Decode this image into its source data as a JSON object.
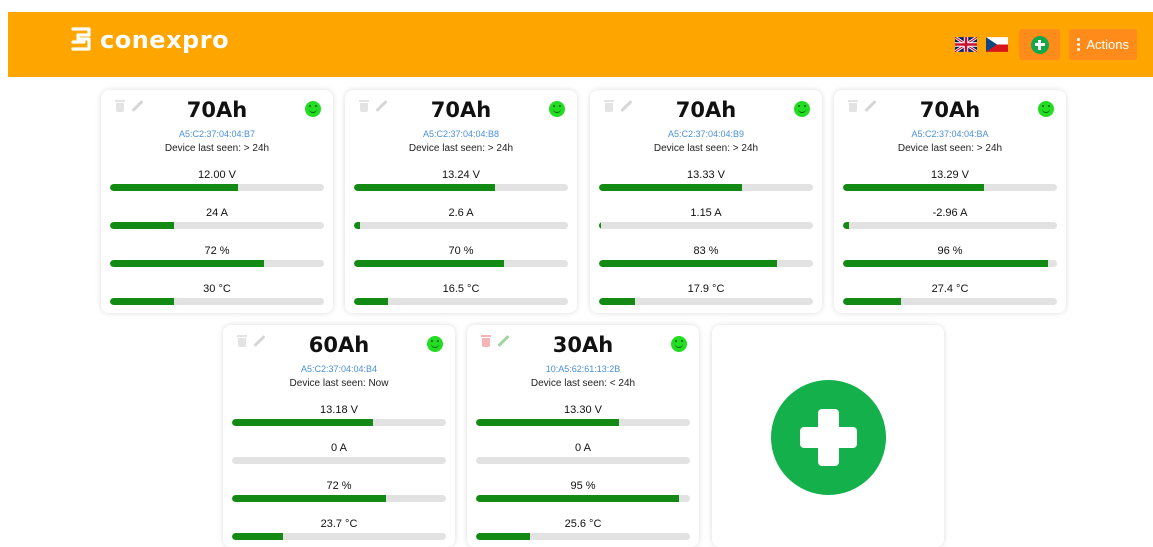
{
  "header": {
    "brand": "conexpro",
    "lang_en_icon": "uk-flag-icon",
    "lang_cz_icon": "cz-flag-icon",
    "add_icon": "plus-circle-icon",
    "actions_label": "Actions",
    "brand_color": "#ffa500",
    "button_color": "#ff8c1a"
  },
  "cards": [
    {
      "capacity": "70Ah",
      "mac": "A5:C2:37:04:04:B7",
      "seen": "Device last seen: > 24h",
      "metrics": [
        {
          "label": "12.00 V",
          "level": 60
        },
        {
          "label": "24 A",
          "level": 30
        },
        {
          "label": "72 %",
          "level": 72
        },
        {
          "label": "30 °C",
          "level": 30
        }
      ]
    },
    {
      "capacity": "70Ah",
      "mac": "A5:C2:37:04:04:B8",
      "seen": "Device last seen: > 24h",
      "metrics": [
        {
          "label": "13.24 V",
          "level": 66
        },
        {
          "label": "2.6 A",
          "level": 3
        },
        {
          "label": "70 %",
          "level": 70
        },
        {
          "label": "16.5 °C",
          "level": 16
        }
      ]
    },
    {
      "capacity": "70Ah",
      "mac": "A5:C2:37:04:04:B9",
      "seen": "Device last seen: > 24h",
      "metrics": [
        {
          "label": "13.33 V",
          "level": 67
        },
        {
          "label": "1.15 A",
          "level": 1
        },
        {
          "label": "83 %",
          "level": 83
        },
        {
          "label": "17.9 °C",
          "level": 17
        }
      ]
    },
    {
      "capacity": "70Ah",
      "mac": "A5:C2:37:04:04:BA",
      "seen": "Device last seen: > 24h",
      "metrics": [
        {
          "label": "13.29 V",
          "level": 66
        },
        {
          "label": "-2.96 A",
          "level": 3
        },
        {
          "label": "96 %",
          "level": 96
        },
        {
          "label": "27.4 °C",
          "level": 27
        }
      ]
    },
    {
      "capacity": "60Ah",
      "mac": "A5:C2:37:04:04:B4",
      "seen": "Device last seen: Now",
      "metrics": [
        {
          "label": "13.18 V",
          "level": 66
        },
        {
          "label": "0 A",
          "level": 0
        },
        {
          "label": "72 %",
          "level": 72
        },
        {
          "label": "23.7 °C",
          "level": 24
        }
      ]
    },
    {
      "capacity": "30Ah",
      "mac": "10:A5:62:61:13:2B",
      "seen": "Device last seen: < 24h",
      "metrics": [
        {
          "label": "13.30 V",
          "level": 67
        },
        {
          "label": "0 A",
          "level": 0
        },
        {
          "label": "95 %",
          "level": 95
        },
        {
          "label": "25.6 °C",
          "level": 25
        }
      ]
    }
  ],
  "add_card": {
    "icon": "big-plus-icon"
  },
  "colors": {
    "bar_fill": "#138a13",
    "bar_track": "#e2e2e2",
    "status_ok": "#22dd22",
    "add": "#13b04b",
    "mac_text": "#4a90d9"
  }
}
